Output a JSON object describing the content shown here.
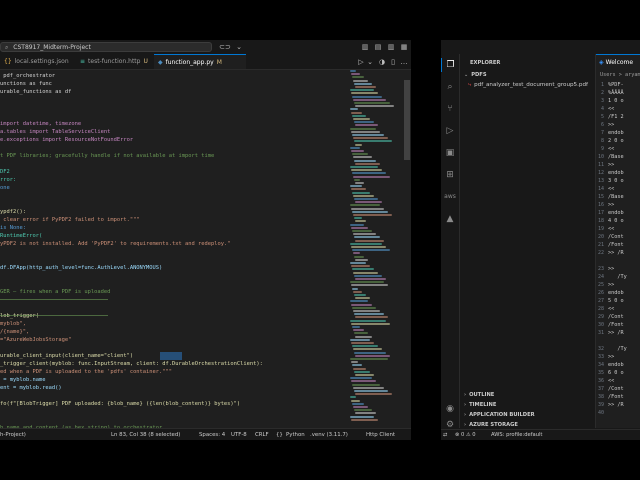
{
  "left_window": {
    "search_text": "CST8917_Midterm-Project",
    "tabs": [
      {
        "label": "local.settings.json",
        "icon": "braces-icon",
        "modified": ""
      },
      {
        "label": "test-function.http",
        "icon": "http-icon",
        "modified": "U"
      },
      {
        "label": "function_app.py",
        "icon": "python-icon",
        "modified": "M"
      }
    ],
    "code_lines": [
      {
        "text": " pdf_orchestrator",
        "color": "#d4d4d4"
      },
      {
        "text": "unctions as func",
        "color": "#d4d4d4"
      },
      {
        "text": "urable_functions as df",
        "color": "#d4d4d4"
      },
      {
        "text": "",
        "color": "#d4d4d4"
      },
      {
        "text": "",
        "color": "#d4d4d4"
      },
      {
        "text": "",
        "color": "#d4d4d4"
      },
      {
        "text": "import datetime, timezone",
        "color": "#c586c0"
      },
      {
        "text": "a.tables import TableServiceClient",
        "color": "#c586c0"
      },
      {
        "text": "e.exceptions import ResourceNotFoundError",
        "color": "#c586c0"
      },
      {
        "text": "",
        "color": "#d4d4d4"
      },
      {
        "text": "t PDF libraries; gracefully handle if not available at import time",
        "color": "#6a9955"
      },
      {
        "text": "",
        "color": "#d4d4d4"
      },
      {
        "text": "DF2",
        "color": "#4ec9b0"
      },
      {
        "text": "rror:",
        "color": "#4ec9b0"
      },
      {
        "text": "one",
        "color": "#569cd6"
      },
      {
        "text": "",
        "color": "#d4d4d4"
      },
      {
        "text": "",
        "color": "#d4d4d4"
      },
      {
        "text": "ypdf2():",
        "color": "#dcdcaa"
      },
      {
        "text": " clear error if PyPDF2 failed to import.\"\"\"",
        "color": "#ce9178"
      },
      {
        "text": "is None:",
        "color": "#569cd6"
      },
      {
        "text": "RuntimeError(",
        "color": "#4ec9b0"
      },
      {
        "text": "yPDF2 is not installed. Add 'PyPDF2' to requirements.txt and redeploy.\"",
        "color": "#ce9178"
      },
      {
        "text": "",
        "color": "#d4d4d4"
      },
      {
        "text": "",
        "color": "#d4d4d4"
      },
      {
        "text": "df.DFApp(http_auth_level=func.AuthLevel.ANONYMOUS)",
        "color": "#9cdcfe"
      },
      {
        "text": "",
        "color": "#d4d4d4"
      },
      {
        "text": "",
        "color": "#d4d4d4"
      },
      {
        "text": "GER — fires when a PDF is uploaded",
        "color": "#6a9955"
      },
      {
        "text": "",
        "color": "#d4d4d4"
      },
      {
        "text": "",
        "color": "#d4d4d4"
      },
      {
        "text": "lob_trigger(",
        "color": "#dcdcaa"
      },
      {
        "text": "myblob\",",
        "color": "#ce9178"
      },
      {
        "text": "/{name}\",",
        "color": "#ce9178"
      },
      {
        "text": "=\"AzureWebJobsStorage\"",
        "color": "#ce9178"
      },
      {
        "text": "",
        "color": "#d4d4d4"
      },
      {
        "text": "urable_client_input(client_name=\"client\")",
        "color": "#dcdcaa"
      },
      {
        "text": "_trigger_client(myblob: func.InputStream, client: df.DurableOrchestrationClient):",
        "color": "#dcdcaa"
      },
      {
        "text": "ed when a PDF is uploaded to the 'pdfs' container.\"\"\"",
        "color": "#ce9178"
      },
      {
        "text": " = myblob.name",
        "color": "#9cdcfe"
      },
      {
        "text": "ent = myblob.read()",
        "color": "#9cdcfe"
      },
      {
        "text": "",
        "color": "#d4d4d4"
      },
      {
        "text": "fo(f\"[BlobTrigger] PDF uploaded: {blob_name} ({len(blob_content)} bytes)\")",
        "color": "#dcdcaa"
      },
      {
        "text": "",
        "color": "#d4d4d4"
      },
      {
        "text": "",
        "color": "#d4d4d4"
      },
      {
        "text": "h name and content (as hex string) to orchestrator",
        "color": "#6a9955"
      }
    ],
    "status": {
      "project": "h-Project)",
      "position": "Ln 83, Col 38 (8 selected)",
      "spaces": "Spaces: 4",
      "encoding": "UTF-8",
      "eol": "CRLF",
      "braces": "{}",
      "language": "Python",
      "python_env": ".venv (3.11.7)",
      "http_client": "Http Client"
    }
  },
  "right_window": {
    "explorer_title": "EXPLORER",
    "folder": "PDFS",
    "file": "pdf_analyzer_test_document_group5.pdf",
    "outline": "OUTLINE",
    "timeline": "TIMELINE",
    "app_builder": "APPLICATION BUILDER",
    "azure_storage": "AZURE STORAGE",
    "welcome_tab": "Welcome",
    "breadcrumb": "Users > aryam",
    "doc_lines": [
      {
        "num": "1",
        "text": "%PDF-"
      },
      {
        "num": "2",
        "text": "%ÂÂÂÂ"
      },
      {
        "num": "3",
        "text": "1 0 o"
      },
      {
        "num": "4",
        "text": "<<"
      },
      {
        "num": "5",
        "text": "/F1 2"
      },
      {
        "num": "6",
        "text": ">>"
      },
      {
        "num": "7",
        "text": "endob"
      },
      {
        "num": "8",
        "text": "2 0 o"
      },
      {
        "num": "9",
        "text": "<<"
      },
      {
        "num": "10",
        "text": "/Base"
      },
      {
        "num": "11",
        "text": ">>"
      },
      {
        "num": "12",
        "text": "endob"
      },
      {
        "num": "13",
        "text": "3 0 o"
      },
      {
        "num": "14",
        "text": "<<"
      },
      {
        "num": "15",
        "text": "/Base"
      },
      {
        "num": "16",
        "text": ">>"
      },
      {
        "num": "17",
        "text": "endob"
      },
      {
        "num": "18",
        "text": "4 0 o"
      },
      {
        "num": "19",
        "text": "<<"
      },
      {
        "num": "20",
        "text": "/Cont"
      },
      {
        "num": "21",
        "text": "/Font"
      },
      {
        "num": "22",
        "text": ">> /R"
      },
      {
        "num": "",
        "text": ""
      },
      {
        "num": "23",
        "text": ">>"
      },
      {
        "num": "24",
        "text": "   /Ty"
      },
      {
        "num": "25",
        "text": ">>"
      },
      {
        "num": "26",
        "text": "endob"
      },
      {
        "num": "27",
        "text": "5 0 o"
      },
      {
        "num": "28",
        "text": "<<"
      },
      {
        "num": "29",
        "text": "/Cont"
      },
      {
        "num": "30",
        "text": "/Font"
      },
      {
        "num": "31",
        "text": ">> /R"
      },
      {
        "num": "",
        "text": ""
      },
      {
        "num": "32",
        "text": "   /Ty"
      },
      {
        "num": "33",
        "text": ">>"
      },
      {
        "num": "34",
        "text": "endob"
      },
      {
        "num": "35",
        "text": "6 0 o"
      },
      {
        "num": "36",
        "text": "<<"
      },
      {
        "num": "37",
        "text": "/Cont"
      },
      {
        "num": "38",
        "text": "/Font"
      },
      {
        "num": "39",
        "text": ">> /R"
      },
      {
        "num": "40",
        "text": ""
      }
    ],
    "status": {
      "errors": "0",
      "warnings": "0",
      "aws": "AWS: profile:default"
    }
  },
  "left_status_aws": "AWS: profile:default"
}
